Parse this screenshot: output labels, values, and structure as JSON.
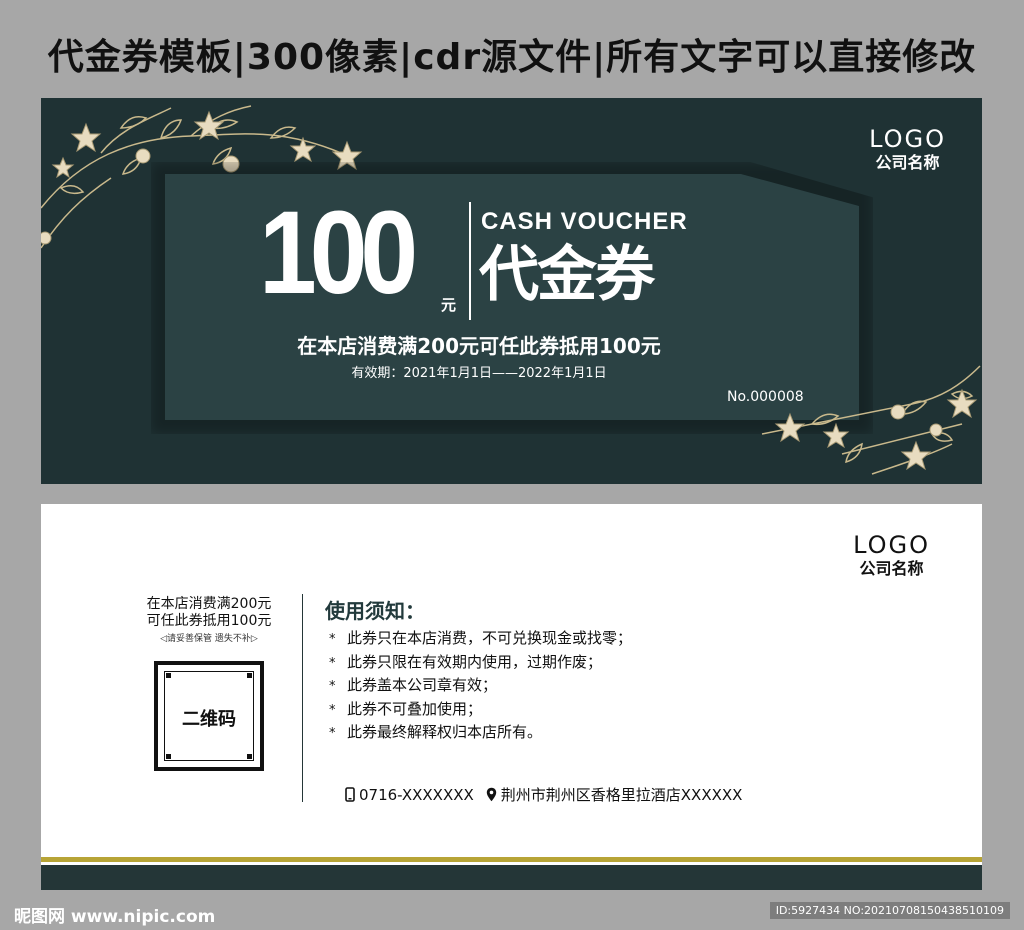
{
  "header": {
    "title": "代金券模板|300像素|cdr源文件|所有文字可以直接修改"
  },
  "front": {
    "logo": "LOGO",
    "company": "公司名称",
    "amount": "100",
    "amount_unit": "元",
    "english_title": "CASH VOUCHER",
    "chinese_title": "代金券",
    "description": "在本店消费满200元可任此券抵用100元",
    "validity": "有效期：2021年1月1日——2022年1月1日",
    "serial": "No.000008",
    "colors": {
      "background": "#1f3234",
      "panel": "#2b4244",
      "floral": "#d9cba8"
    }
  },
  "back": {
    "logo": "LOGO",
    "company": "公司名称",
    "left_line1": "在本店消费满200元",
    "left_line2": "可任此券抵用100元",
    "left_tip": "◁请妥善保管  遗失不补▷",
    "qr_label": "二维码",
    "notice_title": "使用须知：",
    "notice_items": [
      "此券只在本店消费，不可兑换现金或找零；",
      "此券只限在有效期内使用，过期作废；",
      "此券盖本公司章有效；",
      "此券不可叠加使用；",
      "此券最终解释权归本店所有。"
    ],
    "phone": "0716-XXXXXXX",
    "address": "荆州市荆州区香格里拉酒店XXXXXX",
    "colors": {
      "gold": "#b7a436",
      "dark": "#243637"
    }
  },
  "watermark": {
    "site": "昵图网 www.nipic.com",
    "id": "ID:5927434 NO:20210708150438510109"
  }
}
